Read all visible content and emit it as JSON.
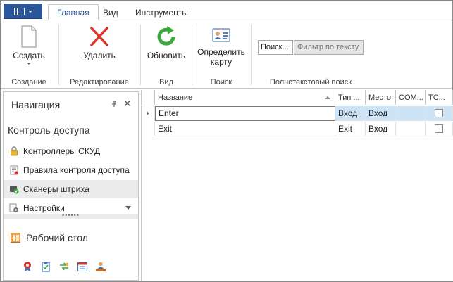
{
  "tabs": {
    "home": "Главная",
    "view": "Вид",
    "tools": "Инструменты"
  },
  "ribbon": {
    "create": {
      "label": "Создать",
      "group": "Создание"
    },
    "delete": {
      "label": "Удалить",
      "group": "Редактирование"
    },
    "refresh": {
      "label": "Обновить",
      "group": "Вид"
    },
    "identify": {
      "label_line1": "Определить",
      "label_line2": "карту",
      "group": "Поиск"
    },
    "fulltext": {
      "search_text": "Поиск...",
      "filter_text": "Фильтр по тексту",
      "group": "Полнотекстовый поиск"
    }
  },
  "nav": {
    "title": "Навигация",
    "group_title": "Контроль доступа",
    "items": [
      {
        "label": "Контроллеры СКУД",
        "icon": "lock-icon"
      },
      {
        "label": "Правила контроля доступа",
        "icon": "rules-icon"
      },
      {
        "label": "Сканеры штриха",
        "icon": "scanner-icon"
      },
      {
        "label": "Настройки",
        "icon": "settings-icon"
      }
    ],
    "splitter": "••••••",
    "desktop": "Рабочий стол"
  },
  "grid": {
    "columns": [
      "Название",
      "Тип ...",
      "Место",
      "COM...",
      "TC..."
    ],
    "rows": [
      {
        "name": "Enter",
        "type": "Вход",
        "place": "Вход",
        "com": "",
        "tc": false
      },
      {
        "name": "Exit",
        "type": "Exit",
        "place": "Вход",
        "com": "",
        "tc": false
      }
    ]
  },
  "colors": {
    "accent": "#2b579a",
    "selection": "#cde4f7",
    "delete_red": "#d9352b",
    "refresh_green": "#3aa83a"
  }
}
